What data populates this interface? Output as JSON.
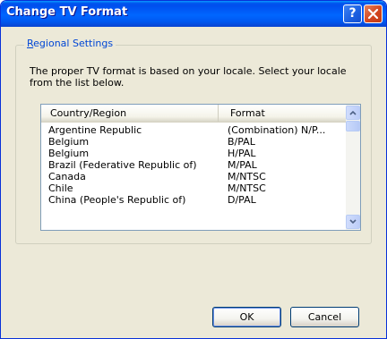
{
  "window": {
    "title": "Change TV Format"
  },
  "titlebar_buttons": {
    "help": "?",
    "close": "close"
  },
  "group": {
    "legend_accel": "R",
    "legend_rest": "egional Settings"
  },
  "description": "The proper TV format is based on your locale. Select your locale from the list below.",
  "list": {
    "columns": [
      "Country/Region",
      "Format"
    ],
    "rows": [
      [
        "Argentine Republic",
        "(Combination) N/P..."
      ],
      [
        "Belgium",
        "B/PAL"
      ],
      [
        "Belgium",
        "H/PAL"
      ],
      [
        "Brazil (Federative Republic of)",
        "M/PAL"
      ],
      [
        "Canada",
        "M/NTSC"
      ],
      [
        "Chile",
        "M/NTSC"
      ],
      [
        "China (People's Republic of)",
        "D/PAL"
      ]
    ]
  },
  "buttons": {
    "ok": "OK",
    "cancel": "Cancel"
  },
  "colors": {
    "title_bar": "#0058f0",
    "dialog_bg": "#ece9d8",
    "legend_text": "#0046d5",
    "close_button": "#d3461f"
  }
}
